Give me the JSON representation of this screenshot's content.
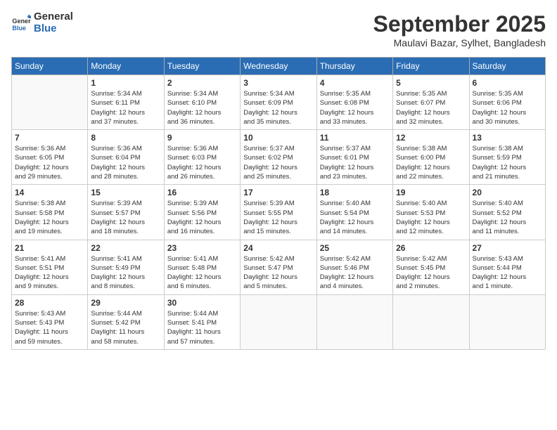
{
  "logo": {
    "general": "General",
    "blue": "Blue"
  },
  "header": {
    "month": "September 2025",
    "location": "Maulavi Bazar, Sylhet, Bangladesh"
  },
  "weekdays": [
    "Sunday",
    "Monday",
    "Tuesday",
    "Wednesday",
    "Thursday",
    "Friday",
    "Saturday"
  ],
  "weeks": [
    [
      {
        "day": "",
        "info": ""
      },
      {
        "day": "1",
        "info": "Sunrise: 5:34 AM\nSunset: 6:11 PM\nDaylight: 12 hours\nand 37 minutes."
      },
      {
        "day": "2",
        "info": "Sunrise: 5:34 AM\nSunset: 6:10 PM\nDaylight: 12 hours\nand 36 minutes."
      },
      {
        "day": "3",
        "info": "Sunrise: 5:34 AM\nSunset: 6:09 PM\nDaylight: 12 hours\nand 35 minutes."
      },
      {
        "day": "4",
        "info": "Sunrise: 5:35 AM\nSunset: 6:08 PM\nDaylight: 12 hours\nand 33 minutes."
      },
      {
        "day": "5",
        "info": "Sunrise: 5:35 AM\nSunset: 6:07 PM\nDaylight: 12 hours\nand 32 minutes."
      },
      {
        "day": "6",
        "info": "Sunrise: 5:35 AM\nSunset: 6:06 PM\nDaylight: 12 hours\nand 30 minutes."
      }
    ],
    [
      {
        "day": "7",
        "info": "Sunrise: 5:36 AM\nSunset: 6:05 PM\nDaylight: 12 hours\nand 29 minutes."
      },
      {
        "day": "8",
        "info": "Sunrise: 5:36 AM\nSunset: 6:04 PM\nDaylight: 12 hours\nand 28 minutes."
      },
      {
        "day": "9",
        "info": "Sunrise: 5:36 AM\nSunset: 6:03 PM\nDaylight: 12 hours\nand 26 minutes."
      },
      {
        "day": "10",
        "info": "Sunrise: 5:37 AM\nSunset: 6:02 PM\nDaylight: 12 hours\nand 25 minutes."
      },
      {
        "day": "11",
        "info": "Sunrise: 5:37 AM\nSunset: 6:01 PM\nDaylight: 12 hours\nand 23 minutes."
      },
      {
        "day": "12",
        "info": "Sunrise: 5:38 AM\nSunset: 6:00 PM\nDaylight: 12 hours\nand 22 minutes."
      },
      {
        "day": "13",
        "info": "Sunrise: 5:38 AM\nSunset: 5:59 PM\nDaylight: 12 hours\nand 21 minutes."
      }
    ],
    [
      {
        "day": "14",
        "info": "Sunrise: 5:38 AM\nSunset: 5:58 PM\nDaylight: 12 hours\nand 19 minutes."
      },
      {
        "day": "15",
        "info": "Sunrise: 5:39 AM\nSunset: 5:57 PM\nDaylight: 12 hours\nand 18 minutes."
      },
      {
        "day": "16",
        "info": "Sunrise: 5:39 AM\nSunset: 5:56 PM\nDaylight: 12 hours\nand 16 minutes."
      },
      {
        "day": "17",
        "info": "Sunrise: 5:39 AM\nSunset: 5:55 PM\nDaylight: 12 hours\nand 15 minutes."
      },
      {
        "day": "18",
        "info": "Sunrise: 5:40 AM\nSunset: 5:54 PM\nDaylight: 12 hours\nand 14 minutes."
      },
      {
        "day": "19",
        "info": "Sunrise: 5:40 AM\nSunset: 5:53 PM\nDaylight: 12 hours\nand 12 minutes."
      },
      {
        "day": "20",
        "info": "Sunrise: 5:40 AM\nSunset: 5:52 PM\nDaylight: 12 hours\nand 11 minutes."
      }
    ],
    [
      {
        "day": "21",
        "info": "Sunrise: 5:41 AM\nSunset: 5:51 PM\nDaylight: 12 hours\nand 9 minutes."
      },
      {
        "day": "22",
        "info": "Sunrise: 5:41 AM\nSunset: 5:49 PM\nDaylight: 12 hours\nand 8 minutes."
      },
      {
        "day": "23",
        "info": "Sunrise: 5:41 AM\nSunset: 5:48 PM\nDaylight: 12 hours\nand 6 minutes."
      },
      {
        "day": "24",
        "info": "Sunrise: 5:42 AM\nSunset: 5:47 PM\nDaylight: 12 hours\nand 5 minutes."
      },
      {
        "day": "25",
        "info": "Sunrise: 5:42 AM\nSunset: 5:46 PM\nDaylight: 12 hours\nand 4 minutes."
      },
      {
        "day": "26",
        "info": "Sunrise: 5:42 AM\nSunset: 5:45 PM\nDaylight: 12 hours\nand 2 minutes."
      },
      {
        "day": "27",
        "info": "Sunrise: 5:43 AM\nSunset: 5:44 PM\nDaylight: 12 hours\nand 1 minute."
      }
    ],
    [
      {
        "day": "28",
        "info": "Sunrise: 5:43 AM\nSunset: 5:43 PM\nDaylight: 11 hours\nand 59 minutes."
      },
      {
        "day": "29",
        "info": "Sunrise: 5:44 AM\nSunset: 5:42 PM\nDaylight: 11 hours\nand 58 minutes."
      },
      {
        "day": "30",
        "info": "Sunrise: 5:44 AM\nSunset: 5:41 PM\nDaylight: 11 hours\nand 57 minutes."
      },
      {
        "day": "",
        "info": ""
      },
      {
        "day": "",
        "info": ""
      },
      {
        "day": "",
        "info": ""
      },
      {
        "day": "",
        "info": ""
      }
    ]
  ]
}
